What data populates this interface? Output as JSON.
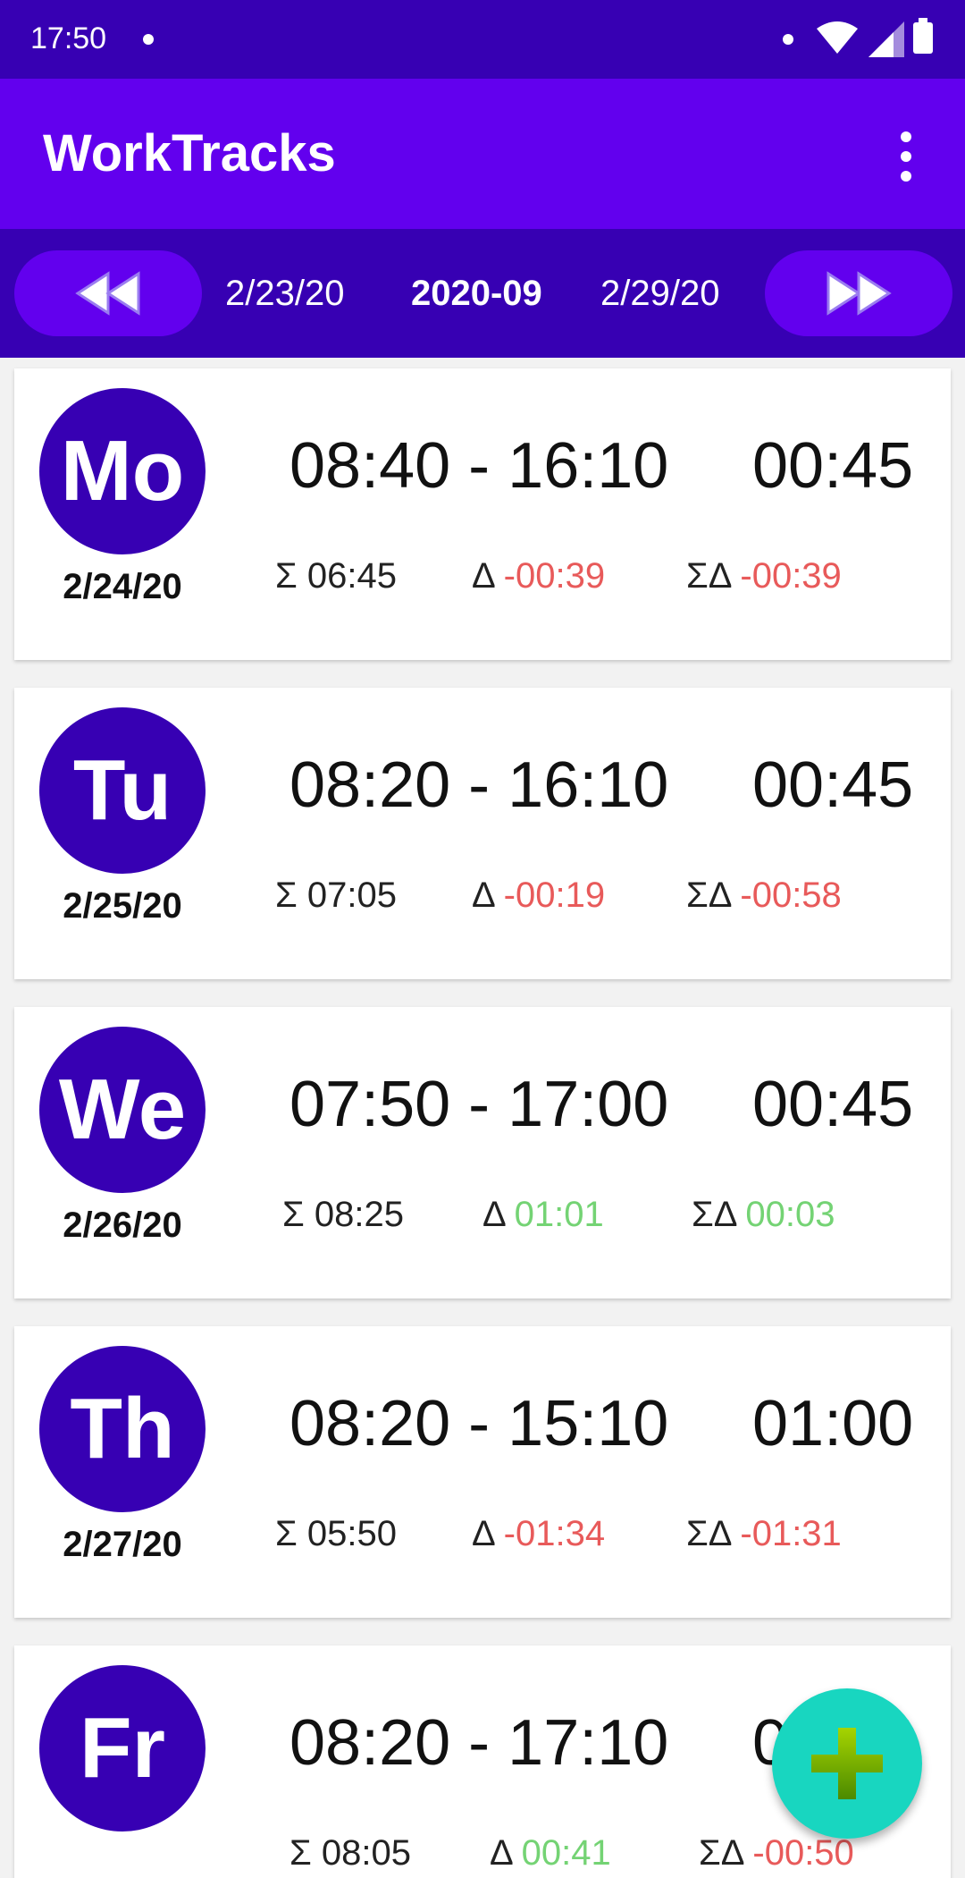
{
  "status_bar": {
    "time": "17:50"
  },
  "app_bar": {
    "title": "WorkTracks",
    "menu_icon": "more-vert-icon"
  },
  "week_nav": {
    "prev_icon": "rewind-icon",
    "next_icon": "fast-forward-icon",
    "start_date": "2/23/20",
    "week_label": "2020-09",
    "end_date": "2/29/20"
  },
  "days": [
    {
      "abbr": "Mo",
      "date": "2/24/20",
      "range": "08:40 - 16:10",
      "break": "00:45",
      "sum_symbol": "Σ",
      "sum": "06:45",
      "delta_symbol": "Δ",
      "delta": "-00:39",
      "sum_delta_symbol": "ΣΔ",
      "sum_delta": "-00:39"
    },
    {
      "abbr": "Tu",
      "date": "2/25/20",
      "range": "08:20 - 16:10",
      "break": "00:45",
      "sum_symbol": "Σ",
      "sum": "07:05",
      "delta_symbol": "Δ",
      "delta": "-00:19",
      "sum_delta_symbol": "ΣΔ",
      "sum_delta": "-00:58"
    },
    {
      "abbr": "We",
      "date": "2/26/20",
      "range": "07:50 - 17:00",
      "break": "00:45",
      "sum_symbol": "Σ",
      "sum": "08:25",
      "delta_symbol": "Δ",
      "delta": "01:01",
      "sum_delta_symbol": "ΣΔ",
      "sum_delta": "00:03"
    },
    {
      "abbr": "Th",
      "date": "2/27/20",
      "range": "08:20 - 15:10",
      "break": "01:00",
      "sum_symbol": "Σ",
      "sum": "05:50",
      "delta_symbol": "Δ",
      "delta": "-01:34",
      "sum_delta_symbol": "ΣΔ",
      "sum_delta": "-01:31"
    },
    {
      "abbr": "Fr",
      "date": "",
      "range": "08:20 - 17:10",
      "break": "00:45",
      "sum_symbol": "Σ",
      "sum": "08:05",
      "delta_symbol": "Δ",
      "delta": "00:41",
      "sum_delta_symbol": "ΣΔ",
      "sum_delta": "-00:50"
    }
  ],
  "fab": {
    "icon": "add-icon"
  },
  "colors": {
    "primary": "#6200ee",
    "primary_dark": "#3700b3",
    "negative": "#e85a5a",
    "positive": "#74d374",
    "fab": "#18d6c0"
  }
}
